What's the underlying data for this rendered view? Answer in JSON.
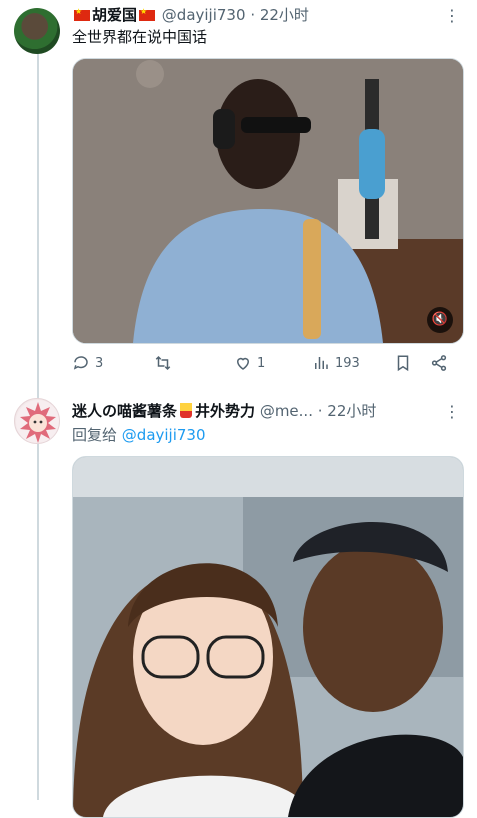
{
  "tweet1": {
    "name": "胡爱国",
    "handle": "@dayiji730",
    "time": "· 22小时",
    "text": "全世界都在说中国话",
    "actions": {
      "replies": "3",
      "retweets": "",
      "likes": "1",
      "views": "193"
    }
  },
  "tweet2": {
    "name_part1": "迷人の喵酱薯条",
    "name_part2": "井外势力",
    "handle": "@me...",
    "time": "· 22小时",
    "reply_label": "回复给",
    "reply_handle": "@dayiji730"
  },
  "colors": {
    "link": "#1d9bf0",
    "muted": "#536471",
    "flag": "#de2910"
  },
  "icons": [
    "more-icon",
    "reply-icon",
    "retweet-icon",
    "like-icon",
    "views-icon",
    "bookmark-icon",
    "share-icon",
    "mute-icon"
  ]
}
